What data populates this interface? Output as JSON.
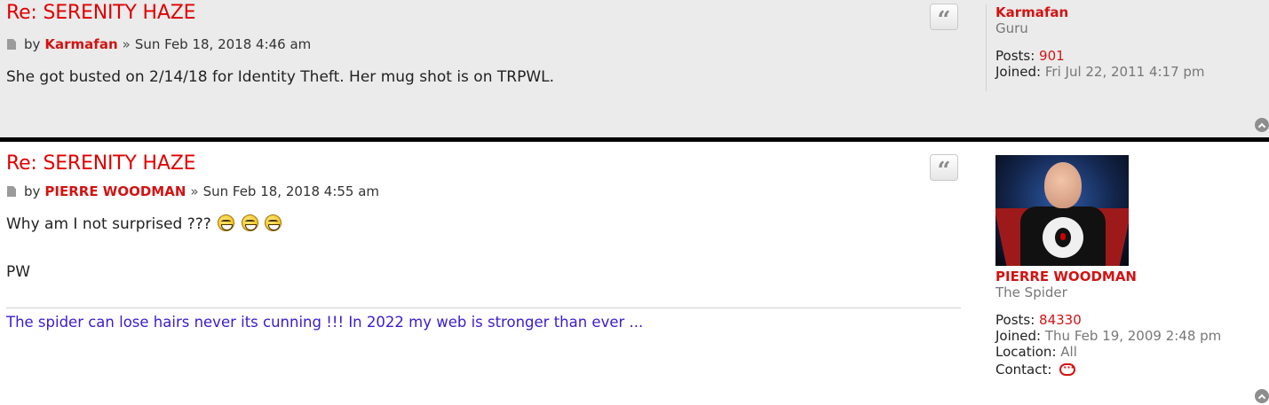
{
  "posts": [
    {
      "title": "Re: SERENITY HAZE",
      "by": "by",
      "author": "Karmafan",
      "separator": "»",
      "date": "Sun Feb 18, 2018 4:46 am",
      "content": "She got busted on 2/14/18 for Identity Theft. Her mug shot is on TRPWL.",
      "profile": {
        "username": "Karmafan",
        "rank": "Guru",
        "posts_label": "Posts:",
        "posts_value": "901",
        "joined_label": "Joined:",
        "joined_value": "Fri Jul 22, 2011 4:17 pm"
      }
    },
    {
      "title": "Re: SERENITY HAZE",
      "by": "by",
      "author": "PIERRE WOODMAN",
      "separator": "»",
      "date": "Sun Feb 18, 2018 4:55 am",
      "content_line1": "Why am I not surprised ???",
      "content_line2": "PW",
      "signature": "The spider can lose hairs never its cunning !!! In 2022 my web is stronger than ever ...",
      "profile": {
        "username": "PIERRE WOODMAN",
        "rank": "The Spider",
        "posts_label": "Posts:",
        "posts_value": "84330",
        "joined_label": "Joined:",
        "joined_value": "Thu Feb 19, 2009 2:48 pm",
        "location_label": "Location:",
        "location_value": "All",
        "contact_label": "Contact:"
      }
    }
  ],
  "icons": {
    "quote": "quote-icon",
    "post": "post-document-icon",
    "top": "back-to-top-icon",
    "contact": "speech-bubble-icon",
    "emoji": "grinning-face-emoji"
  },
  "colors": {
    "title": "#e10000",
    "author": "#d31313",
    "signature": "#3b1ccf",
    "post1_bg": "#ebebeb",
    "post2_bg": "#ffffff"
  }
}
